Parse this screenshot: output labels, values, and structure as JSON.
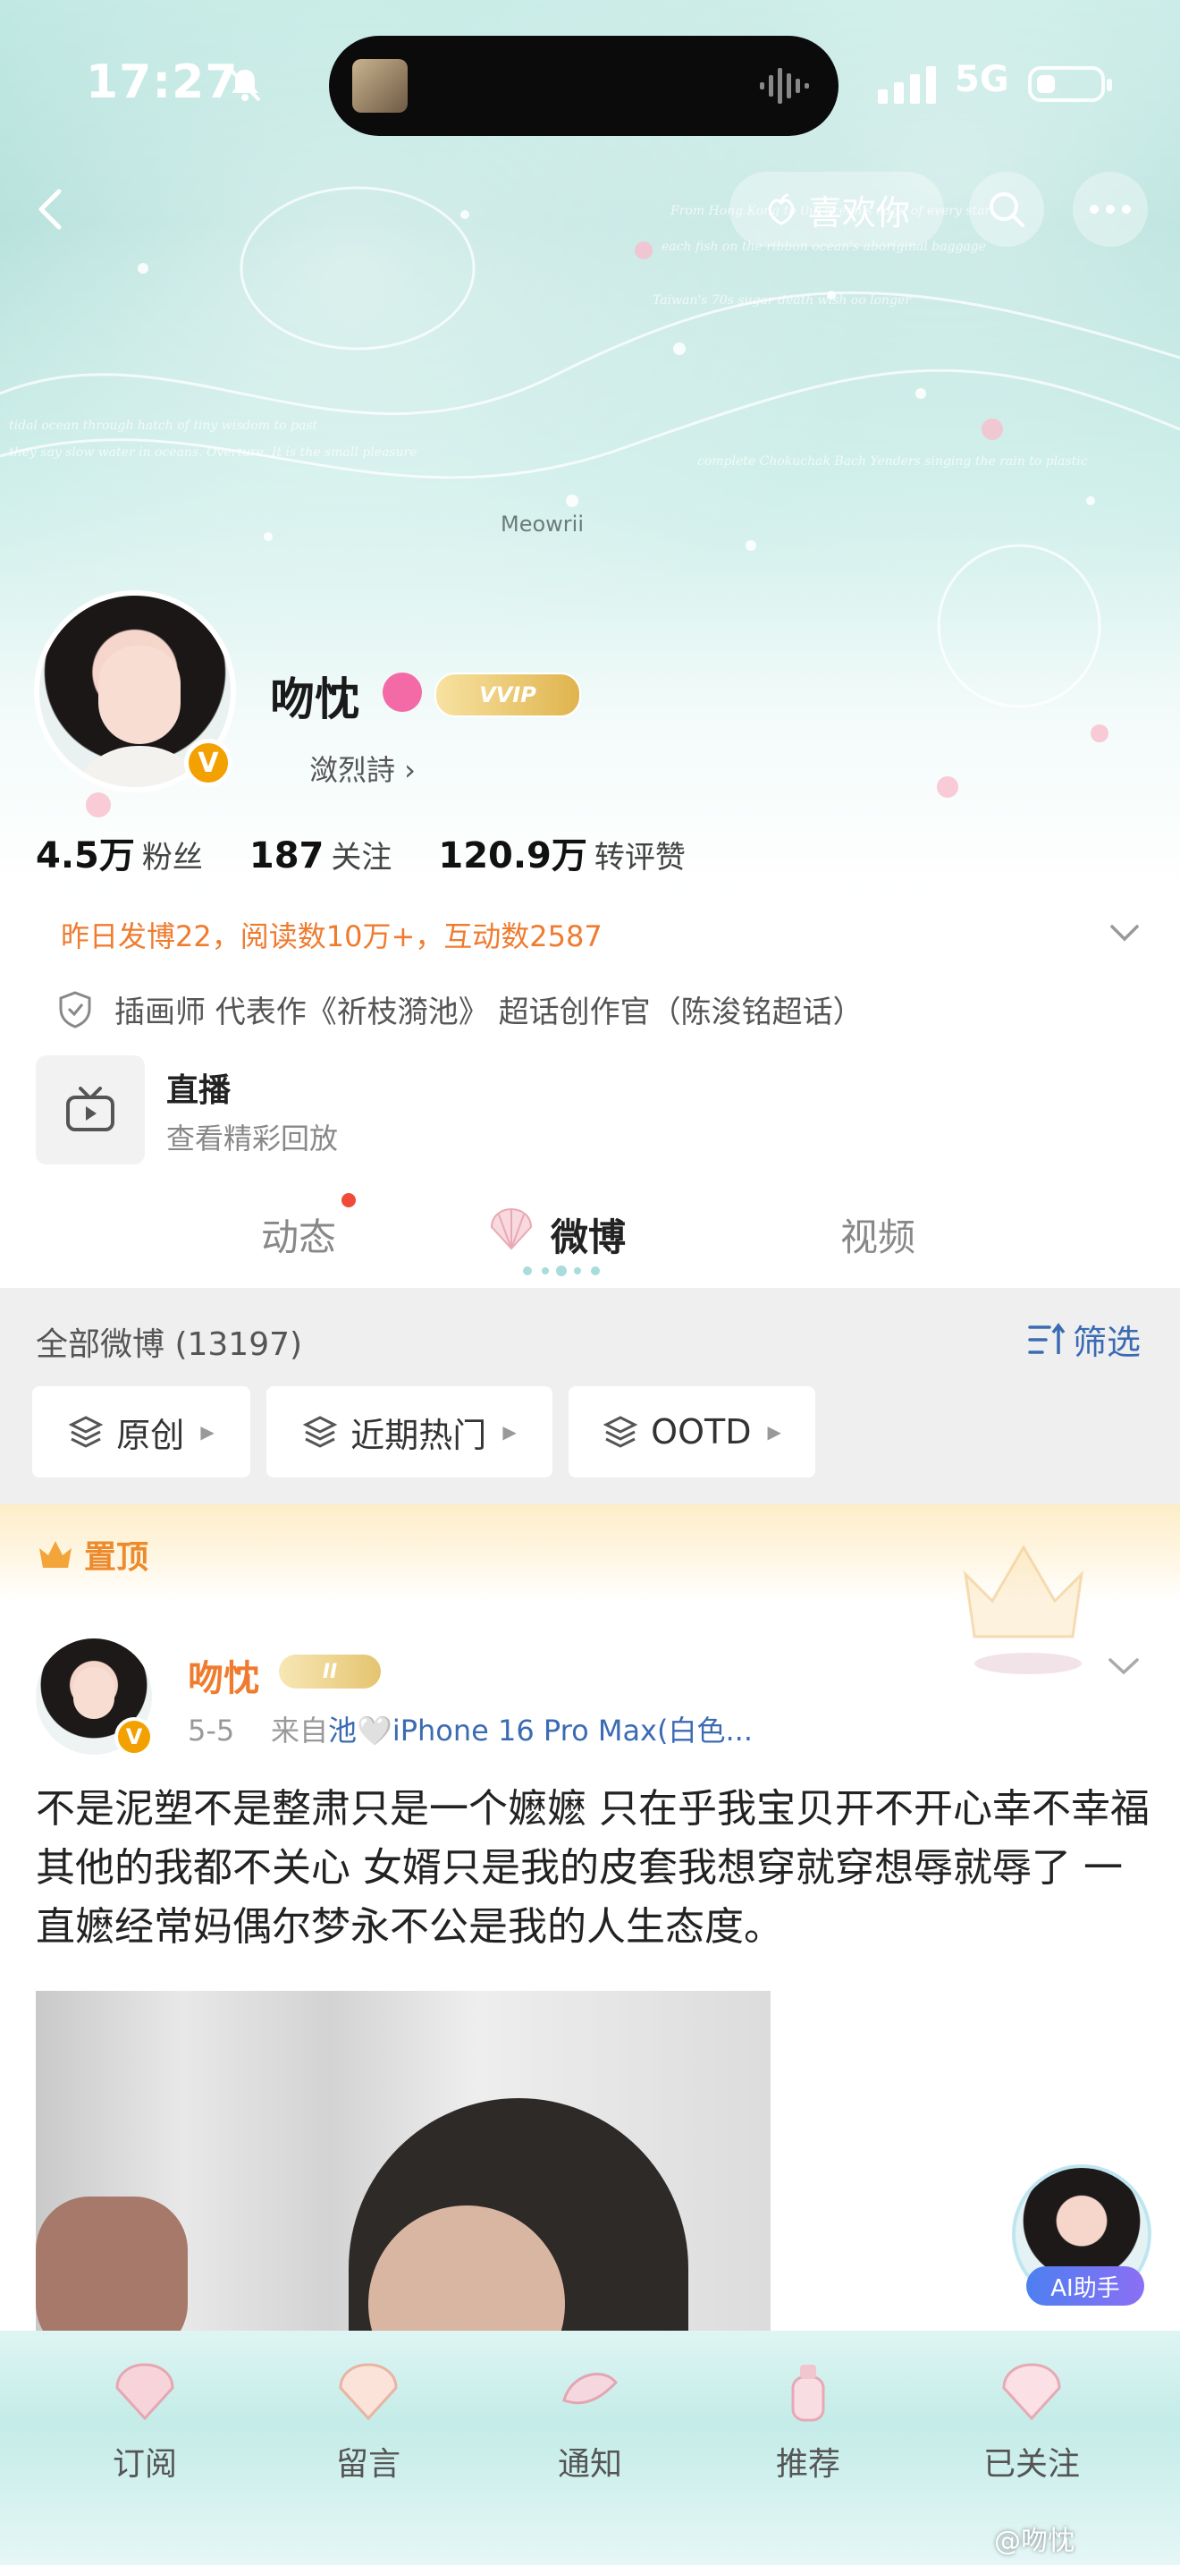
{
  "status_bar": {
    "time": "17:27",
    "network": "5G"
  },
  "header": {
    "like_label": "喜欢你"
  },
  "profile": {
    "username": "吻忱",
    "vip_text": "VVIP",
    "sub_tag": "潋烈詩 ›",
    "stats": [
      {
        "value": "4.5万",
        "label": "粉丝"
      },
      {
        "value": "187",
        "label": "关注"
      },
      {
        "value": "120.9万",
        "label": "转评赞"
      }
    ]
  },
  "banner_text": "Meowrii",
  "notice": "昨日发博22，阅读数10万+，互动数2587",
  "certification": "插画师 代表作《祈枝漪池》 超话创作官（陈浚铭超话）",
  "live": {
    "title": "直播",
    "subtitle": "查看精彩回放"
  },
  "tabs": [
    {
      "label": "动态"
    },
    {
      "label": "微博"
    },
    {
      "label": "视频"
    }
  ],
  "feed": {
    "title": "全部微博 (13197)",
    "filter_label": "筛选",
    "chips": [
      "原创",
      "近期热门",
      "OOTD"
    ]
  },
  "pinned": {
    "label": "置顶"
  },
  "post": {
    "author": "吻忱",
    "badge": "II",
    "date": "5-5",
    "source_prefix": "来自",
    "source": "池🤍iPhone 16 Pro Max(白色...",
    "text": "不是泥塑不是整肃只是一个嬷嬷 只在乎我宝贝开不开心幸不幸福其他的我都不关心 女婿只是我的皮套我想穿就穿想辱就辱了 一直嬷经常妈偶尔梦永不公是我的人生态度。"
  },
  "ai_helper": "AI助手",
  "bottom_nav": [
    "订阅",
    "留言",
    "通知",
    "推荐",
    "已关注"
  ],
  "watermark": "@吻忱",
  "colors": {
    "accent_orange": "#ef7b2f",
    "link_blue": "#3b6bb3",
    "vip_gold": "#e0b44e",
    "hero_teal": "#a9dcd5"
  }
}
